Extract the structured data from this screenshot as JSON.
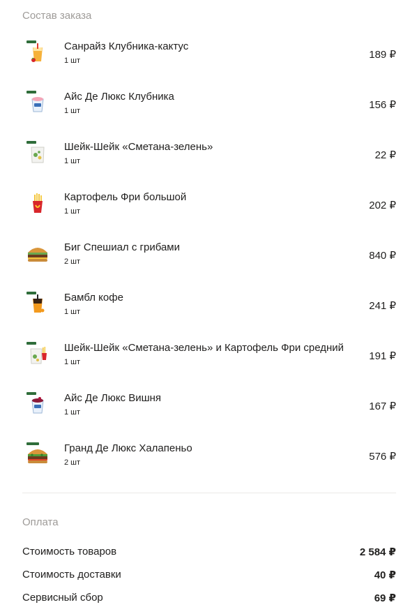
{
  "order": {
    "title": "Состав заказа",
    "items": [
      {
        "name": "Санрайз Клубника-кактус",
        "qty": "1 шт",
        "price": "189 ₽",
        "image": "strawberry-drink"
      },
      {
        "name": "Айс Де Люкс Клубника",
        "qty": "1 шт",
        "price": "156 ₽",
        "image": "ice-cream-cup"
      },
      {
        "name": "Шейк-Шейк «Сметана-зелень»",
        "qty": "1 шт",
        "price": "22 ₽",
        "image": "seasoning-packet"
      },
      {
        "name": "Картофель Фри большой",
        "qty": "1 шт",
        "price": "202 ₽",
        "image": "french-fries"
      },
      {
        "name": "Биг Спешиал с грибами",
        "qty": "2 шт",
        "price": "840 ₽",
        "image": "burger"
      },
      {
        "name": "Бамбл кофе",
        "qty": "1 шт",
        "price": "241 ₽",
        "image": "orange-coffee-drink"
      },
      {
        "name": "Шейк-Шейк «Сметана-зелень» и Картофель Фри средний",
        "qty": "1 шт",
        "price": "191 ₽",
        "image": "fries-shake-combo"
      },
      {
        "name": "Айс Де Люкс Вишня",
        "qty": "1 шт",
        "price": "167 ₽",
        "image": "ice-cream-cup-cherry"
      },
      {
        "name": "Гранд Де Люкс Халапеньо",
        "qty": "2 шт",
        "price": "576 ₽",
        "image": "jalapeno-burger"
      }
    ]
  },
  "payment": {
    "title": "Оплата",
    "rows": [
      {
        "label": "Стоимость товаров",
        "value": "2 584 ₽"
      },
      {
        "label": "Стоимость доставки",
        "value": "40 ₽"
      },
      {
        "label": "Сервисный сбор",
        "value": "69 ₽"
      }
    ]
  },
  "colors": {
    "text": "#21201f",
    "muted": "#9e9b98",
    "divider": "#ebe9e6",
    "tag_green": "#2f6d3a"
  }
}
